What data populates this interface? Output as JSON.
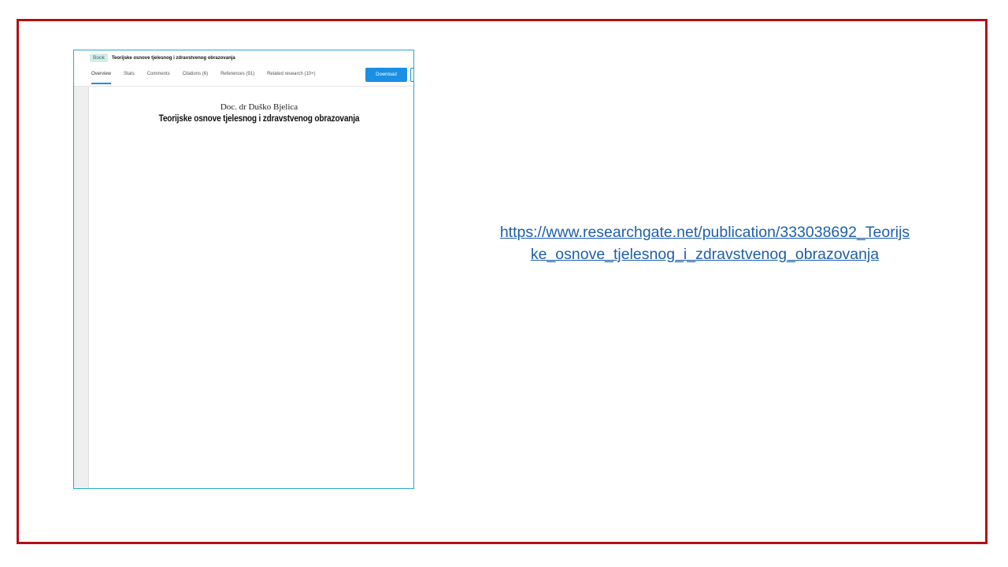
{
  "screenshot": {
    "badge": "Book",
    "title": "Teorijske osnove tjelesnog i zdravstvenog obrazovanja",
    "tabs": [
      {
        "label": "Overview",
        "active": true
      },
      {
        "label": "Stats",
        "active": false
      },
      {
        "label": "Comments",
        "active": false
      },
      {
        "label": "Citations (6)",
        "active": false
      },
      {
        "label": "References (91)",
        "active": false
      },
      {
        "label": "Related research (10+)",
        "active": false
      }
    ],
    "download_label": "Download",
    "document": {
      "author": "Doc. dr Duško Bjelica",
      "title": "Teorijske osnove tjelesnog i zdravstvenog obrazovanja"
    }
  },
  "link": {
    "line1": "https://www.researchgate.net/publication/333038692_Teorijs",
    "line2": "ke_osnove_tjelesnog_i_zdravstvenog_obrazovanja"
  },
  "colors": {
    "frame_border": "#b11116",
    "screenshot_border": "#2aa7c9",
    "download_button": "#1a8fe3",
    "link": "#1f5fa8"
  }
}
